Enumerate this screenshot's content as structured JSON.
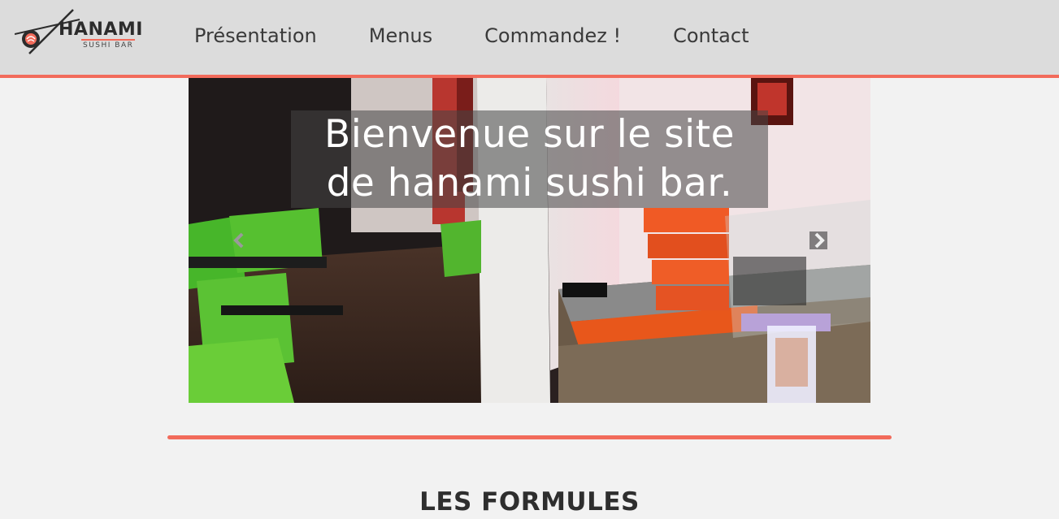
{
  "brand": {
    "name": "HANAMI",
    "subtitle": "SUSHI BAR",
    "accent_color": "#f26b5b"
  },
  "nav": {
    "items": [
      {
        "label": "Présentation"
      },
      {
        "label": "Menus"
      },
      {
        "label": "Commandez !"
      },
      {
        "label": "Contact"
      }
    ]
  },
  "carousel": {
    "caption_line1": "Bienvenue sur le site",
    "caption_line2": "de hanami sushi bar.",
    "prev_icon": "chevron-left-icon",
    "next_icon": "chevron-right-icon"
  },
  "sections": {
    "formules_title": "LES FORMULES"
  }
}
